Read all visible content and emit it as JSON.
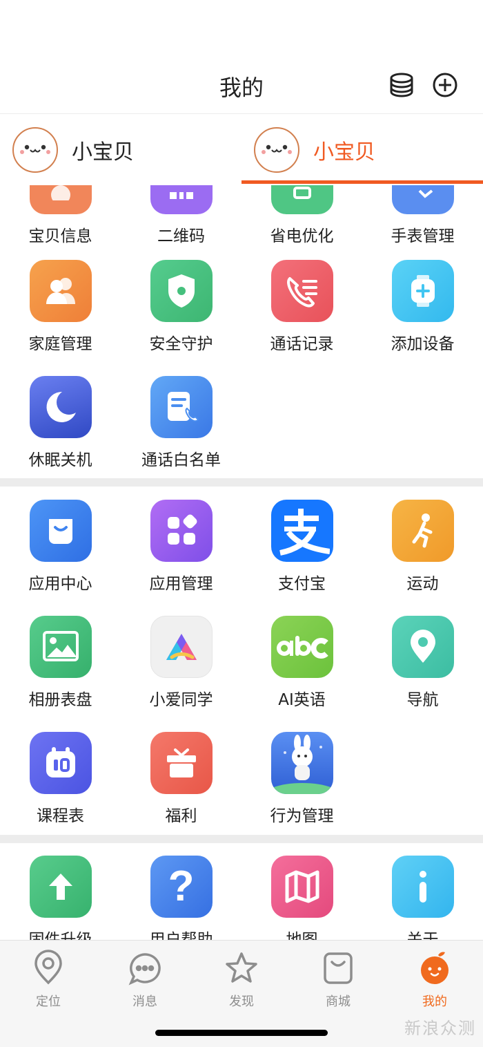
{
  "header": {
    "title": "我的"
  },
  "profiles": [
    {
      "name": "小宝贝",
      "active": false
    },
    {
      "name": "小宝贝",
      "active": true
    }
  ],
  "sections": [
    {
      "items": [
        {
          "label": "宝贝信息",
          "icon": "baby-info-icon",
          "color": "#f1865a"
        },
        {
          "label": "二维码",
          "icon": "qr-code-icon",
          "color": "#9b6cf2"
        },
        {
          "label": "省电优化",
          "icon": "battery-saver-icon",
          "color": "#4fc684"
        },
        {
          "label": "手表管理",
          "icon": "watch-manage-icon",
          "color": "#5a8ef0"
        }
      ]
    },
    {
      "items": [
        {
          "label": "家庭管理",
          "icon": "family-icon",
          "color": "#f39343"
        },
        {
          "label": "安全守护",
          "icon": "shield-icon",
          "color": "#45c07d"
        },
        {
          "label": "通话记录",
          "icon": "call-log-icon",
          "color": "#ee6066"
        },
        {
          "label": "添加设备",
          "icon": "add-device-icon",
          "color": "#42c6f2"
        }
      ]
    },
    {
      "items": [
        {
          "label": "休眠关机",
          "icon": "moon-icon",
          "color": "#4a64d8"
        },
        {
          "label": "通话白名单",
          "icon": "whitelist-icon",
          "color": "#4a8ef0"
        }
      ]
    },
    {
      "items": [
        {
          "label": "应用中心",
          "icon": "shopping-bag-icon",
          "color": "#3f84f0"
        },
        {
          "label": "应用管理",
          "icon": "app-grid-icon",
          "color": "#9a5cf0"
        },
        {
          "label": "支付宝",
          "icon": "alipay-icon",
          "color": "#1677ff"
        },
        {
          "label": "运动",
          "icon": "running-icon",
          "color": "#f4a431"
        }
      ]
    },
    {
      "items": [
        {
          "label": "相册表盘",
          "icon": "gallery-icon",
          "color": "#45c07d"
        },
        {
          "label": "小爱同学",
          "icon": "xiaoai-icon",
          "color": "#f0f0f0"
        },
        {
          "label": "AI英语",
          "icon": "abc-icon",
          "color": "#7dcc49"
        },
        {
          "label": "导航",
          "icon": "location-pin-icon",
          "color": "#4dcab0"
        }
      ]
    },
    {
      "items": [
        {
          "label": "课程表",
          "icon": "schedule-icon",
          "color": "#5963ec"
        },
        {
          "label": "福利",
          "icon": "gift-icon",
          "color": "#ef6658"
        },
        {
          "label": "行为管理",
          "icon": "rabbit-astronaut-icon",
          "color": "#3a6fe0"
        }
      ]
    },
    {
      "items": [
        {
          "label": "固件升级",
          "icon": "upgrade-arrow-icon",
          "color": "#48c47f"
        },
        {
          "label": "用户帮助",
          "icon": "question-icon",
          "color": "#4a86ee"
        },
        {
          "label": "地图",
          "icon": "map-icon",
          "color": "#ee5b8c"
        },
        {
          "label": "关于",
          "icon": "info-icon",
          "color": "#45c2f2"
        }
      ]
    }
  ],
  "tabbar": [
    {
      "label": "定位",
      "icon": "location-icon",
      "active": false
    },
    {
      "label": "消息",
      "icon": "message-icon",
      "active": false
    },
    {
      "label": "发现",
      "icon": "star-icon",
      "active": false
    },
    {
      "label": "商城",
      "icon": "shop-bag-icon",
      "active": false
    },
    {
      "label": "我的",
      "icon": "mascot-icon",
      "active": true
    }
  ],
  "colors": {
    "accent": "#f06a1e",
    "active_tab_text": "#f05a22",
    "section_divider": "#ececec"
  },
  "watermark": "新浪众测"
}
